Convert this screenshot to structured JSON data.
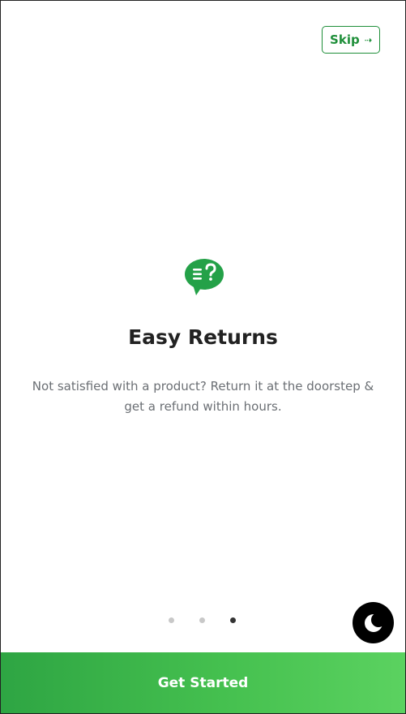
{
  "header": {
    "skip_label": "Skip",
    "skip_icon": "arrow-right-icon"
  },
  "slide": {
    "icon": "chat-question-icon",
    "title": "Easy Returns",
    "description": "Not satisfied with a product? Return it at the doorstep & get a refund within hours."
  },
  "pagination": {
    "total": 3,
    "active_index": 2
  },
  "theme_toggle": {
    "icon": "moon-icon"
  },
  "footer": {
    "cta_label": "Get Started"
  },
  "colors": {
    "accent": "#2ea543",
    "accent_light": "#5bd260",
    "text_primary": "#222222",
    "text_secondary": "#6b6f74",
    "dot_inactive": "#c8c8c8",
    "dot_active": "#333333"
  }
}
